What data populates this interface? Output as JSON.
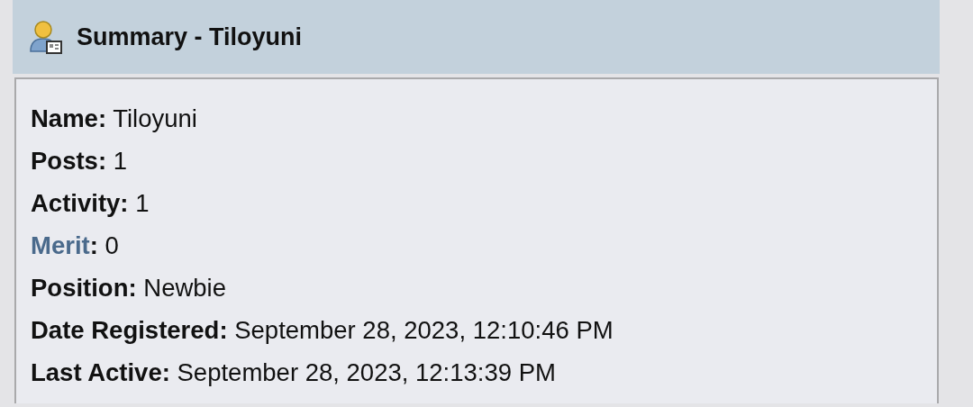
{
  "header": {
    "title": "Summary - Tiloyuni"
  },
  "fields": [
    {
      "kind": "text",
      "label": "Name",
      "separator": ":",
      "value": "Tiloyuni"
    },
    {
      "kind": "text",
      "label": "Posts",
      "separator": ":",
      "value": "1"
    },
    {
      "kind": "text",
      "label": "Activity",
      "separator": ":",
      "value": "1"
    },
    {
      "kind": "link",
      "label": "Merit",
      "separator": ":",
      "value": "0"
    },
    {
      "kind": "text",
      "label": "Position",
      "separator": ":",
      "value": "Newbie"
    },
    {
      "kind": "text",
      "label": "Date Registered",
      "separator": ":",
      "value": "September 28, 2023, 12:10:46 PM"
    },
    {
      "kind": "text",
      "label": "Last Active",
      "separator": ":",
      "value": "September 28, 2023, 12:13:39 PM"
    }
  ]
}
